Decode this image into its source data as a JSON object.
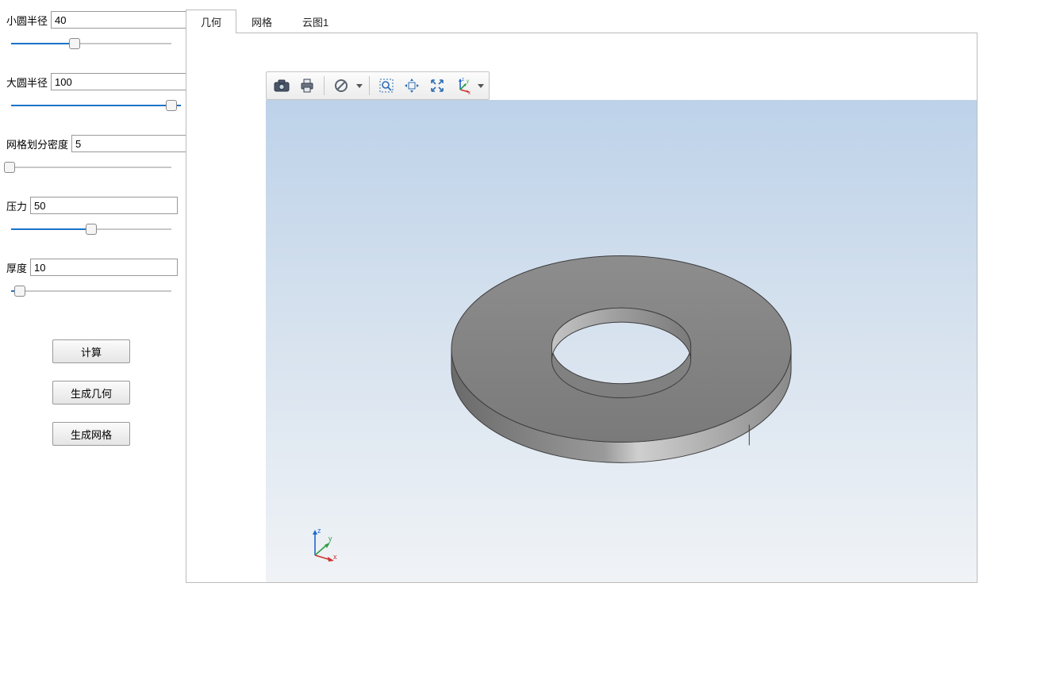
{
  "sidebar": {
    "params": [
      {
        "label": "小圆半径",
        "value": "40",
        "fill_pct": 40,
        "thumb_pct": 40
      },
      {
        "label": "大圆半径",
        "value": "100",
        "fill_pct": 100,
        "thumb_pct": 97
      },
      {
        "label": "网格划分密度",
        "value": "5",
        "fill_pct": 2,
        "thumb_pct": 2
      },
      {
        "label": "压力",
        "value": "50",
        "fill_pct": 50,
        "thumb_pct": 50
      },
      {
        "label": "厚度",
        "value": "10",
        "fill_pct": 8,
        "thumb_pct": 8
      }
    ],
    "buttons": {
      "compute": "计算",
      "gen_geometry": "生成几何",
      "gen_mesh": "生成网格"
    }
  },
  "tabs": [
    {
      "id": "geometry",
      "label": "几何",
      "active": true
    },
    {
      "id": "mesh",
      "label": "网格",
      "active": false
    },
    {
      "id": "contour1",
      "label": "云图1",
      "active": false
    }
  ],
  "toolbar": {
    "camera_icon": "camera-icon",
    "print_icon": "print-icon",
    "noselect_icon": "no-entry-icon",
    "zoombox_icon": "zoom-box-icon",
    "pan_icon": "pan-arrows-icon",
    "fit_icon": "fit-extents-icon",
    "axes_icon": "axes-orientation-icon"
  },
  "axis_labels": {
    "x": "x",
    "y": "y",
    "z": "z"
  }
}
